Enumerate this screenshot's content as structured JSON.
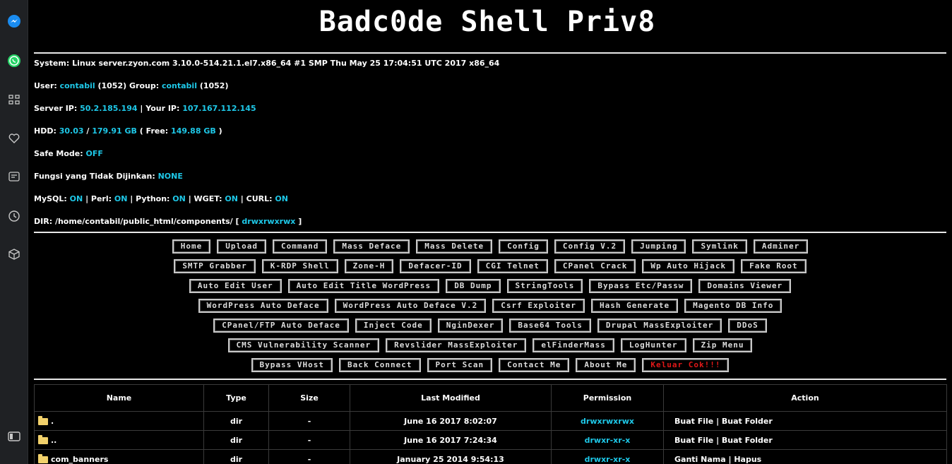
{
  "sidebar": {
    "icons": [
      "messenger-icon",
      "whatsapp-icon",
      "apps-grid-icon",
      "heart-icon",
      "news-icon",
      "clock-icon",
      "cube-icon",
      "sidebar-toggle-icon"
    ]
  },
  "header": {
    "title": "Badc0de Shell Priv8"
  },
  "system": {
    "label": "System:",
    "value": "Linux server.zyon.com 3.10.0-514.21.1.el7.x86_64 #1 SMP Thu May 25 17:04:51 UTC 2017 x86_64"
  },
  "user": {
    "label": "User:",
    "user": "contabil",
    "uid": "(1052)",
    "group_label": "Group:",
    "group": "contabil",
    "gid": "(1052)"
  },
  "ip": {
    "server_label": "Server IP:",
    "server": "50.2.185.194",
    "sep": "|",
    "your_label": "Your IP:",
    "your": "107.167.112.145"
  },
  "hdd": {
    "label": "HDD:",
    "used": "30.03",
    "slash": "/",
    "total": "179.91 GB",
    "free_open": "( Free:",
    "free": "149.88 GB",
    "free_close": ")"
  },
  "safe_mode": {
    "label": "Safe Mode:",
    "value": "OFF"
  },
  "disabled": {
    "label": "Fungsi yang Tidak Dijinkan:",
    "value": "NONE"
  },
  "services": {
    "mysql_label": "MySQL:",
    "mysql": "ON",
    "perl_label": "| Perl:",
    "perl": "ON",
    "python_label": "| Python:",
    "python": "ON",
    "wget_label": "| WGET:",
    "wget": "ON",
    "curl_label": "| CURL:",
    "curl": "ON"
  },
  "dir": {
    "label": "DIR:",
    "path": "/home/contabil/public_html/components/",
    "open": "[",
    "perm": "drwxrwxrwx",
    "close": "]"
  },
  "menu_rows": [
    [
      "Home",
      "Upload",
      "Command",
      "Mass Deface",
      "Mass Delete",
      "Config",
      "Config V.2",
      "Jumping",
      "Symlink",
      "Adminer"
    ],
    [
      "SMTP Grabber",
      "K-RDP Shell",
      "Zone-H",
      "Defacer-ID",
      "CGI Telnet",
      "CPanel Crack",
      "Wp Auto Hijack",
      "Fake Root"
    ],
    [
      "Auto Edit User",
      "Auto Edit Title WordPress",
      "DB Dump",
      "StringTools",
      "Bypass Etc/Passw",
      "Domains Viewer"
    ],
    [
      "WordPress Auto Deface",
      "WordPress Auto Deface V.2",
      "Csrf Exploiter",
      "Hash Generate",
      "Magento DB Info"
    ],
    [
      "CPanel/FTP Auto Deface",
      "Inject Code",
      "NginDexer",
      "Base64 Tools",
      "Drupal MassExploiter",
      "DDoS"
    ],
    [
      "CMS Vulnerability Scanner",
      "Revslider MassExploiter",
      "elFinderMass",
      "LogHunter",
      "Zip Menu"
    ],
    [
      "Bypass VHost",
      "Back Connect",
      "Port Scan",
      "Contact Me",
      "About Me",
      "Keluar Cok!!!"
    ]
  ],
  "colors": {
    "accent": "#1ec8e8",
    "danger": "#e01818",
    "background": "#000000",
    "folder": "#f2d16b"
  },
  "table": {
    "headers": [
      "Name",
      "Type",
      "Size",
      "Last Modified",
      "Permission",
      "Action"
    ],
    "rows": [
      {
        "name": ".",
        "type": "dir",
        "size": "-",
        "modified": "June 16 2017 8:02:07",
        "perm": "drwxrwxrwx",
        "action": "Buat File | Buat Folder"
      },
      {
        "name": "..",
        "type": "dir",
        "size": "-",
        "modified": "June 16 2017 7:24:34",
        "perm": "drwxr-xr-x",
        "action": "Buat File | Buat Folder"
      },
      {
        "name": "com_banners",
        "type": "dir",
        "size": "-",
        "modified": "January 25 2014 9:54:13",
        "perm": "drwxr-xr-x",
        "action": "Ganti Nama | Hapus"
      }
    ]
  }
}
